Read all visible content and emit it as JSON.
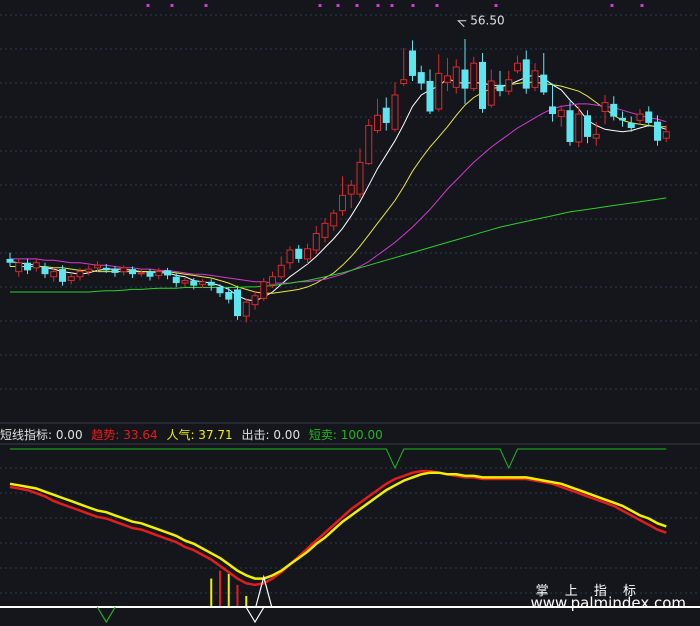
{
  "theme": {
    "background": "#14161c",
    "grid": "#2a3a4a",
    "up": "#d62b2b",
    "down": "#5ee6f0",
    "ma5": "#ffffff",
    "ma10": "#e8e83a",
    "ma20": "#d23ad2",
    "ma60": "#2ecf2e",
    "trend": "#e51c1c",
    "popularity": "#f0f000",
    "short_sell": "#1db81d"
  },
  "chart_data": [
    {
      "type": "candlestick",
      "title": "",
      "annotation": {
        "label": "56.50",
        "at_index": 51,
        "value": 56.5
      },
      "ylim": [
        26.5,
        57.5
      ],
      "grid": true,
      "candles": [
        [
          37.6,
          37.3,
          38.1,
          37.0
        ],
        [
          36.6,
          37.3,
          37.6,
          36.2
        ],
        [
          37.3,
          36.7,
          37.6,
          36.4
        ],
        [
          36.9,
          37.3,
          37.6,
          36.6
        ],
        [
          37.0,
          36.4,
          37.3,
          36.1
        ],
        [
          36.2,
          36.6,
          36.9,
          35.8
        ],
        [
          36.8,
          35.8,
          37.1,
          35.5
        ],
        [
          35.9,
          36.2,
          36.5,
          35.6
        ],
        [
          36.2,
          36.6,
          36.9,
          35.9
        ],
        [
          36.6,
          36.8,
          37.1,
          36.3
        ],
        [
          36.9,
          37.1,
          37.4,
          36.6
        ],
        [
          36.9,
          36.7,
          37.2,
          36.5
        ],
        [
          36.8,
          36.5,
          37.0,
          36.2
        ],
        [
          36.6,
          36.9,
          37.1,
          36.3
        ],
        [
          36.8,
          36.4,
          37.0,
          36.1
        ],
        [
          36.5,
          36.5,
          36.8,
          36.2
        ],
        [
          36.6,
          36.2,
          36.8,
          35.9
        ],
        [
          36.3,
          36.6,
          36.9,
          36.0
        ],
        [
          36.7,
          36.3,
          36.9,
          36.0
        ],
        [
          36.2,
          35.7,
          36.5,
          35.4
        ],
        [
          35.7,
          35.9,
          36.1,
          35.4
        ],
        [
          35.9,
          35.5,
          36.1,
          35.2
        ],
        [
          35.6,
          35.8,
          36.0,
          35.3
        ],
        [
          35.8,
          35.5,
          36.0,
          35.1
        ],
        [
          35.4,
          34.9,
          35.6,
          34.6
        ],
        [
          35.0,
          34.4,
          35.4,
          34.1
        ],
        [
          35.2,
          33.1,
          35.5,
          32.8
        ],
        [
          33.1,
          34.2,
          34.5,
          32.6
        ],
        [
          34.0,
          34.7,
          35.1,
          33.6
        ],
        [
          34.5,
          35.8,
          36.1,
          34.3
        ],
        [
          35.6,
          36.2,
          36.6,
          35.3
        ],
        [
          36.2,
          37.1,
          37.8,
          36.0
        ],
        [
          37.3,
          38.3,
          38.6,
          36.8
        ],
        [
          38.4,
          37.6,
          38.7,
          37.3
        ],
        [
          37.6,
          38.4,
          38.8,
          37.2
        ],
        [
          38.3,
          39.6,
          40.2,
          38.0
        ],
        [
          39.3,
          40.4,
          40.8,
          38.9
        ],
        [
          40.2,
          41.2,
          41.5,
          39.8
        ],
        [
          41.4,
          42.6,
          44.1,
          41.0
        ],
        [
          42.7,
          43.4,
          43.8,
          41.6
        ],
        [
          42.7,
          45.2,
          46.3,
          42.4
        ],
        [
          45.1,
          48.1,
          48.6,
          45.0
        ],
        [
          47.7,
          48.9,
          50.2,
          47.5
        ],
        [
          49.5,
          48.3,
          50.3,
          47.7
        ],
        [
          47.8,
          50.5,
          51.5,
          47.6
        ],
        [
          51.4,
          51.7,
          54.2,
          51.2
        ],
        [
          54.0,
          52.0,
          54.8,
          51.6
        ],
        [
          52.3,
          51.4,
          52.8,
          50.9
        ],
        [
          51.6,
          49.2,
          52.5,
          49.0
        ],
        [
          49.4,
          52.2,
          53.7,
          49.2
        ],
        [
          51.5,
          52.0,
          53.4,
          50.8
        ],
        [
          51.1,
          52.7,
          53.3,
          50.6
        ],
        [
          52.5,
          51.0,
          54.9,
          49.8
        ],
        [
          51.0,
          53.0,
          53.5,
          50.8
        ],
        [
          53.1,
          49.4,
          53.8,
          49.1
        ],
        [
          49.7,
          51.6,
          52.5,
          49.5
        ],
        [
          51.3,
          50.8,
          52.4,
          50.4
        ],
        [
          50.8,
          51.7,
          52.4,
          50.5
        ],
        [
          52.4,
          53.0,
          53.6,
          52.2
        ],
        [
          53.3,
          51.0,
          54.0,
          50.6
        ],
        [
          51.1,
          52.4,
          53.0,
          50.8
        ],
        [
          52.1,
          50.7,
          53.8,
          50.5
        ],
        [
          49.6,
          49.0,
          51.4,
          48.4
        ],
        [
          48.8,
          49.3,
          49.7,
          48.0
        ],
        [
          49.3,
          46.8,
          50.0,
          46.5
        ],
        [
          46.8,
          49.0,
          49.6,
          46.4
        ],
        [
          48.9,
          47.2,
          49.3,
          46.7
        ],
        [
          47.1,
          47.4,
          48.4,
          46.5
        ],
        [
          49.2,
          49.9,
          50.5,
          48.2
        ],
        [
          49.8,
          48.8,
          50.4,
          48.5
        ],
        [
          48.7,
          48.5,
          49.2,
          48.0
        ],
        [
          48.3,
          47.9,
          48.8,
          47.6
        ],
        [
          48.5,
          49.0,
          49.4,
          48.2
        ],
        [
          49.2,
          48.3,
          49.6,
          48.0
        ],
        [
          48.4,
          46.9,
          48.9,
          46.5
        ],
        [
          47.1,
          47.6,
          48.1,
          46.8
        ]
      ],
      "moving_averages": [
        {
          "name": "MA5",
          "color": "#ffffff",
          "values": [
            37.4,
            37.3,
            37.2,
            37.1,
            36.9,
            36.8,
            36.6,
            36.5,
            36.4,
            36.5,
            36.7,
            36.8,
            36.8,
            36.8,
            36.7,
            36.6,
            36.6,
            36.5,
            36.5,
            36.3,
            36.2,
            35.9,
            35.8,
            35.7,
            35.5,
            35.2,
            34.7,
            34.4,
            34.3,
            34.6,
            35.0,
            35.6,
            36.2,
            36.7,
            37.2,
            37.8,
            38.5,
            39.2,
            40.0,
            41.0,
            42.1,
            43.4,
            44.7,
            45.8,
            46.9,
            48.2,
            49.6,
            50.5,
            50.9,
            51.2,
            51.8,
            51.5,
            51.4,
            51.5,
            51.4,
            51.3,
            51.2,
            51.3,
            51.6,
            51.9,
            52.1,
            51.8,
            51.3,
            50.9,
            50.1,
            49.4,
            48.5,
            48.1,
            47.8,
            47.7,
            47.6,
            47.7,
            47.9,
            48.1,
            48.0,
            47.8
          ]
        },
        {
          "name": "MA10",
          "color": "#e8e83a",
          "values": [
            37.0,
            37.0,
            37.0,
            37.0,
            37.0,
            36.9,
            36.9,
            36.8,
            36.7,
            36.7,
            36.6,
            36.6,
            36.6,
            36.6,
            36.6,
            36.6,
            36.6,
            36.6,
            36.6,
            36.5,
            36.4,
            36.3,
            36.2,
            36.1,
            35.9,
            35.7,
            35.4,
            35.2,
            35.0,
            34.9,
            34.9,
            35.0,
            35.1,
            35.2,
            35.4,
            35.7,
            36.1,
            36.5,
            37.1,
            37.8,
            38.6,
            39.5,
            40.4,
            41.3,
            42.2,
            43.3,
            44.5,
            45.5,
            46.4,
            47.2,
            48.0,
            48.9,
            49.7,
            50.3,
            50.7,
            51.0,
            51.1,
            51.3,
            51.4,
            51.5,
            51.5,
            51.4,
            51.3,
            51.2,
            51.0,
            50.8,
            50.4,
            49.9,
            49.4,
            48.9,
            48.5,
            48.3,
            48.2,
            48.1,
            48.0,
            48.0
          ]
        },
        {
          "name": "MA20",
          "color": "#d23ad2",
          "values": [
            37.6,
            37.6,
            37.6,
            37.6,
            37.5,
            37.5,
            37.4,
            37.3,
            37.3,
            37.2,
            37.1,
            37.1,
            37.0,
            36.9,
            36.9,
            36.8,
            36.8,
            36.7,
            36.7,
            36.6,
            36.5,
            36.4,
            36.4,
            36.3,
            36.2,
            36.1,
            36.0,
            35.9,
            35.8,
            35.8,
            35.7,
            35.7,
            35.7,
            35.8,
            35.8,
            35.9,
            36.0,
            36.2,
            36.4,
            36.7,
            37.0,
            37.4,
            37.9,
            38.4,
            38.9,
            39.5,
            40.1,
            40.8,
            41.5,
            42.3,
            43.1,
            43.8,
            44.5,
            45.2,
            45.8,
            46.4,
            46.9,
            47.4,
            47.9,
            48.3,
            48.7,
            49.1,
            49.4,
            49.6,
            49.7,
            49.8,
            49.8,
            49.7,
            49.6,
            49.5,
            49.3,
            49.1,
            48.9,
            48.7,
            48.6,
            48.4
          ]
        },
        {
          "name": "MA60",
          "color": "#2ecf2e",
          "values": [
            35.0,
            35.0,
            35.0,
            35.0,
            35.0,
            35.0,
            35.0,
            35.0,
            35.0,
            35.0,
            35.05,
            35.1,
            35.1,
            35.15,
            35.2,
            35.2,
            35.25,
            35.3,
            35.3,
            35.3,
            35.35,
            35.35,
            35.35,
            35.35,
            35.35,
            35.35,
            35.35,
            35.4,
            35.4,
            35.45,
            35.5,
            35.6,
            35.7,
            35.8,
            35.9,
            36.05,
            36.2,
            36.35,
            36.5,
            36.7,
            36.9,
            37.1,
            37.3,
            37.5,
            37.7,
            37.9,
            38.1,
            38.3,
            38.5,
            38.7,
            38.9,
            39.1,
            39.3,
            39.5,
            39.7,
            39.9,
            40.1,
            40.25,
            40.4,
            40.55,
            40.7,
            40.85,
            41.0,
            41.15,
            41.3,
            41.4,
            41.5,
            41.6,
            41.7,
            41.8,
            41.9,
            42.0,
            42.1,
            42.2,
            42.3,
            42.4
          ]
        }
      ]
    },
    {
      "type": "line",
      "title": "短线指标",
      "legend": [
        {
          "label": "短线指标: 0.00",
          "color": "#e0e0e0"
        },
        {
          "label": "趋势: 33.64",
          "color": "#e51c1c"
        },
        {
          "label": "人气: 37.71",
          "color": "#f0f000"
        },
        {
          "label": "出击: 0.00",
          "color": "#e0e0e0"
        },
        {
          "label": "短卖: 100.00",
          "color": "#1db81d"
        }
      ],
      "ylim": [
        0,
        100
      ],
      "series": [
        {
          "name": "趋势",
          "color": "#e51c1c",
          "values": [
            76,
            75,
            74,
            72,
            70,
            67,
            65,
            63,
            61,
            59,
            57,
            56,
            54,
            52,
            50,
            49,
            47,
            45,
            43,
            41,
            38,
            36,
            33,
            30,
            26,
            22,
            18,
            15,
            14,
            15,
            18,
            22,
            27,
            32,
            37,
            42,
            47,
            52,
            57,
            62,
            66,
            70,
            74,
            78,
            81,
            83,
            85,
            86,
            86,
            85,
            84,
            83,
            82,
            82,
            81,
            81,
            81,
            81,
            81,
            81,
            80,
            79,
            78,
            76,
            74,
            72,
            70,
            68,
            66,
            64,
            61,
            58,
            55,
            52,
            49,
            47
          ]
        },
        {
          "name": "人气",
          "color": "#f0f000",
          "values": [
            78,
            77,
            76,
            75,
            73,
            71,
            69,
            67,
            65,
            63,
            61,
            60,
            58,
            56,
            54,
            53,
            51,
            49,
            47,
            45,
            42,
            40,
            37,
            34,
            31,
            27,
            23,
            20,
            18,
            18,
            20,
            23,
            27,
            31,
            35,
            40,
            44,
            49,
            54,
            58,
            62,
            66,
            70,
            74,
            77,
            80,
            82,
            84,
            85,
            85,
            84,
            84,
            83,
            83,
            82,
            82,
            82,
            82,
            82,
            82,
            81,
            80,
            79,
            78,
            76,
            74,
            72,
            70,
            68,
            66,
            64,
            61,
            58,
            56,
            53,
            51
          ]
        },
        {
          "name": "短卖",
          "color": "#1db81d",
          "values": [
            100,
            100,
            100,
            100,
            100,
            100,
            100,
            100,
            100,
            100,
            100,
            100,
            100,
            100,
            100,
            100,
            100,
            100,
            100,
            100,
            100,
            100,
            100,
            100,
            100,
            100,
            100,
            100,
            100,
            100,
            100,
            100,
            100,
            100,
            100,
            100,
            100,
            100,
            100,
            100,
            100,
            100,
            100,
            100,
            88,
            100,
            100,
            100,
            100,
            100,
            100,
            100,
            100,
            100,
            100,
            100,
            100,
            88,
            100,
            100,
            100,
            100,
            100,
            100,
            100,
            100,
            100,
            100,
            100,
            100,
            100,
            100,
            100,
            100,
            100,
            100
          ]
        }
      ],
      "bars": [
        {
          "index": 23,
          "value": 18,
          "color": "#f0f000"
        },
        {
          "index": 24,
          "value": 23,
          "color": "#e51c1c"
        },
        {
          "index": 25,
          "value": 21,
          "color": "#f0f000"
        },
        {
          "index": 26,
          "value": 14,
          "color": "#e51c1c"
        },
        {
          "index": 27,
          "value": 7,
          "color": "#f0f000"
        }
      ],
      "triangles": [
        {
          "index": 11,
          "dir": "down",
          "color": "#1db81d"
        },
        {
          "index": 28,
          "dir": "down",
          "color": "#ffffff"
        },
        {
          "index": 29,
          "dir": "up",
          "color": "#ffffff"
        }
      ]
    }
  ],
  "watermark": {
    "line1": "掌 上 指 标",
    "line2": "www.palmindex.com"
  }
}
